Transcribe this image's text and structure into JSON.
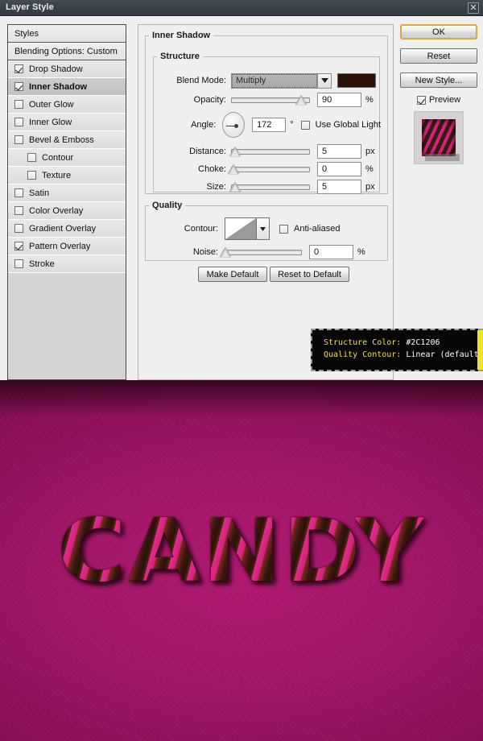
{
  "window": {
    "title": "Layer Style",
    "close_label": "✕"
  },
  "styles_panel": {
    "header": "Styles",
    "blending_options": "Blending Options: Custom",
    "items": [
      {
        "label": "Drop Shadow",
        "checked": true,
        "sub": false,
        "selected": false
      },
      {
        "label": "Inner Shadow",
        "checked": true,
        "sub": false,
        "selected": true
      },
      {
        "label": "Outer Glow",
        "checked": false,
        "sub": false,
        "selected": false
      },
      {
        "label": "Inner Glow",
        "checked": false,
        "sub": false,
        "selected": false
      },
      {
        "label": "Bevel & Emboss",
        "checked": false,
        "sub": false,
        "selected": false
      },
      {
        "label": "Contour",
        "checked": false,
        "sub": true,
        "selected": false
      },
      {
        "label": "Texture",
        "checked": false,
        "sub": true,
        "selected": false
      },
      {
        "label": "Satin",
        "checked": false,
        "sub": false,
        "selected": false
      },
      {
        "label": "Color Overlay",
        "checked": false,
        "sub": false,
        "selected": false
      },
      {
        "label": "Gradient Overlay",
        "checked": false,
        "sub": false,
        "selected": false
      },
      {
        "label": "Pattern Overlay",
        "checked": true,
        "sub": false,
        "selected": false
      },
      {
        "label": "Stroke",
        "checked": false,
        "sub": false,
        "selected": false
      }
    ]
  },
  "panel": {
    "title": "Inner Shadow",
    "structure": {
      "legend": "Structure",
      "blend_mode_label": "Blend Mode:",
      "blend_mode_value": "Multiply",
      "color_swatch": "#2C1206",
      "opacity_label": "Opacity:",
      "opacity_value": "90",
      "opacity_unit": "%",
      "angle_label": "Angle:",
      "angle_value": "172",
      "angle_unit": "°",
      "use_global_light": "Use Global Light",
      "use_global_light_checked": false,
      "distance_label": "Distance:",
      "distance_value": "5",
      "distance_unit": "px",
      "choke_label": "Choke:",
      "choke_value": "0",
      "choke_unit": "%",
      "size_label": "Size:",
      "size_value": "5",
      "size_unit": "px"
    },
    "quality": {
      "legend": "Quality",
      "contour_label": "Contour:",
      "anti_aliased": "Anti-aliased",
      "anti_aliased_checked": false,
      "noise_label": "Noise:",
      "noise_value": "0",
      "noise_unit": "%"
    },
    "make_default": "Make Default",
    "reset_to_default": "Reset to Default"
  },
  "actions": {
    "ok": "OK",
    "reset": "Reset",
    "new_style": "New Style...",
    "preview": "Preview",
    "preview_checked": true
  },
  "tooltip": {
    "line1_key": "Structure Color:",
    "line1_val": "#2C1206",
    "line2_key": "Quality Contour:",
    "line2_val": "Linear (default)"
  },
  "artwork": {
    "word": "CANDY",
    "background_color": "#8D1159",
    "stripe_pink": "#D4217C",
    "stripe_brown": "#2C1206"
  }
}
